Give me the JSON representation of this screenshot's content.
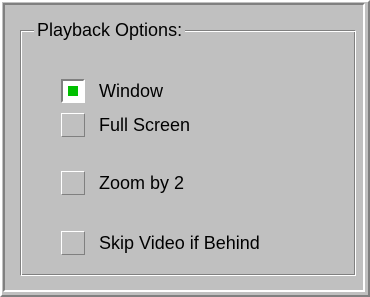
{
  "group": {
    "title": "Playback Options:"
  },
  "options": [
    {
      "label": "Window",
      "checked": true
    },
    {
      "label": "Full Screen",
      "checked": false
    },
    {
      "label": "Zoom by 2",
      "checked": false
    },
    {
      "label": "Skip Video if Behind",
      "checked": false
    }
  ],
  "colors": {
    "face": "#c0c0c0",
    "highlight": "#ffffff",
    "shadow": "#808080",
    "check_mark": "#00c000"
  }
}
